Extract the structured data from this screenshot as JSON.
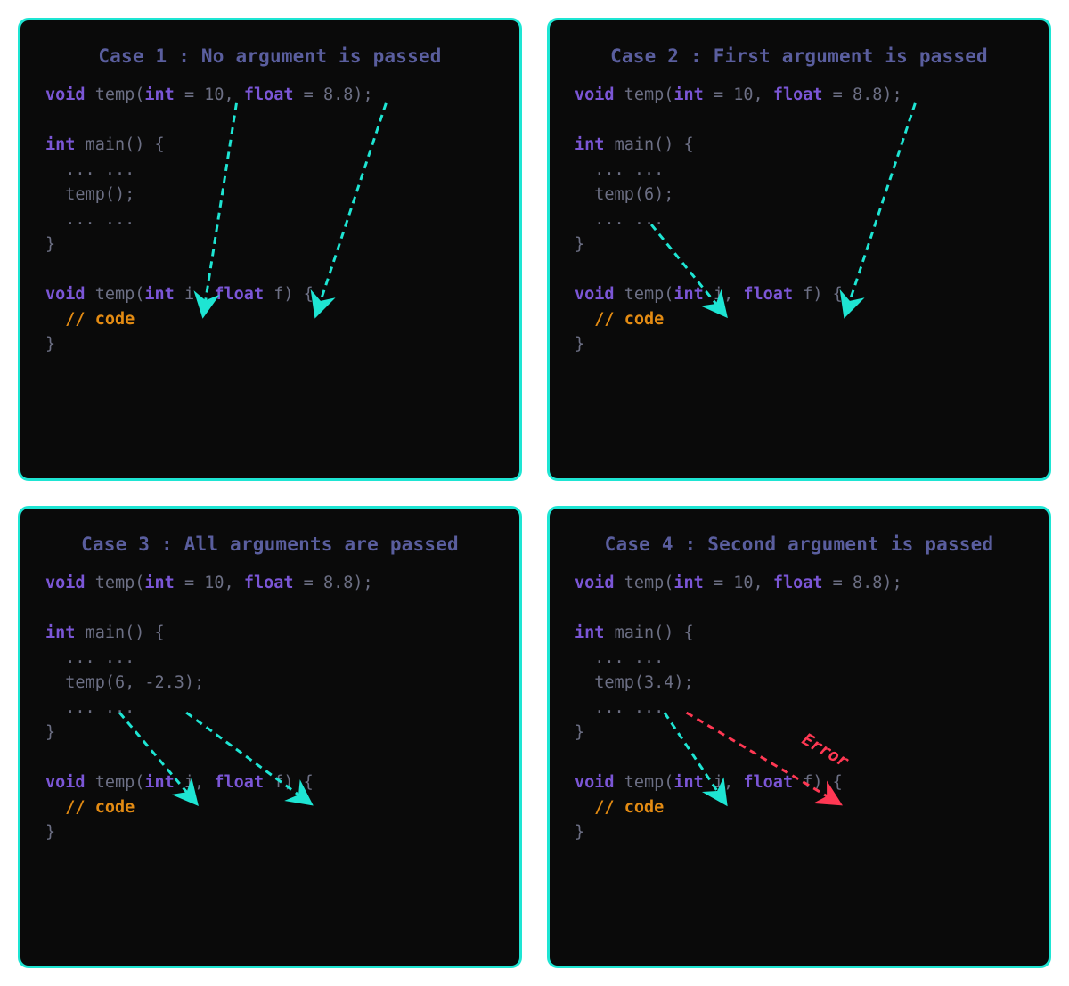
{
  "colors": {
    "panel_bg": "#0a0a0a",
    "panel_border": "#1ee5d3",
    "title": "#5a5e9e",
    "keyword": "#7b56d6",
    "text": "#6c6f84",
    "comment": "#e38b13",
    "arrow": "#1ee5d3",
    "error": "#ff3853"
  },
  "panels": [
    {
      "name": "case-1",
      "title": "Case 1 : No argument is passed",
      "prototype": {
        "kw1": "void",
        "fn": "temp",
        "p1type": "int",
        "p1def": "10",
        "p2type": "float",
        "p2def": "8.8"
      },
      "main_kw": "int",
      "main_fn": "main",
      "dots": "... ...",
      "call": "temp();",
      "definition": {
        "kw1": "void",
        "fn": "temp",
        "p1type": "int",
        "p1name": "i",
        "p2type": "float",
        "p2name": "f"
      },
      "comment": "// code",
      "error_label": "",
      "arrows": [
        "default-int",
        "default-float"
      ]
    },
    {
      "name": "case-2",
      "title": "Case 2 : First argument is passed",
      "prototype": {
        "kw1": "void",
        "fn": "temp",
        "p1type": "int",
        "p1def": "10",
        "p2type": "float",
        "p2def": "8.8"
      },
      "main_kw": "int",
      "main_fn": "main",
      "dots": "... ...",
      "call": "temp(6);",
      "definition": {
        "kw1": "void",
        "fn": "temp",
        "p1type": "int",
        "p1name": "i",
        "p2type": "float",
        "p2name": "f"
      },
      "comment": "// code",
      "error_label": "",
      "arrows": [
        "arg-to-int",
        "default-float"
      ]
    },
    {
      "name": "case-3",
      "title": "Case 3 : All arguments are passed",
      "prototype": {
        "kw1": "void",
        "fn": "temp",
        "p1type": "int",
        "p1def": "10",
        "p2type": "float",
        "p2def": "8.8"
      },
      "main_kw": "int",
      "main_fn": "main",
      "dots": "... ...",
      "call": "temp(6, -2.3);",
      "definition": {
        "kw1": "void",
        "fn": "temp",
        "p1type": "int",
        "p1name": "i",
        "p2type": "float",
        "p2name": "f"
      },
      "comment": "// code",
      "error_label": "",
      "arrows": [
        "arg1-to-int",
        "arg2-to-float"
      ]
    },
    {
      "name": "case-4",
      "title": "Case 4 : Second argument is passed",
      "prototype": {
        "kw1": "void",
        "fn": "temp",
        "p1type": "int",
        "p1def": "10",
        "p2type": "float",
        "p2def": "8.8"
      },
      "main_kw": "int",
      "main_fn": "main",
      "dots": "... ...",
      "call": "temp(3.4);",
      "definition": {
        "kw1": "void",
        "fn": "temp",
        "p1type": "int",
        "p1name": "i",
        "p2type": "float",
        "p2name": "f"
      },
      "comment": "// code",
      "error_label": "Error",
      "arrows": [
        "arg-to-int-4",
        "error-to-float"
      ]
    }
  ]
}
